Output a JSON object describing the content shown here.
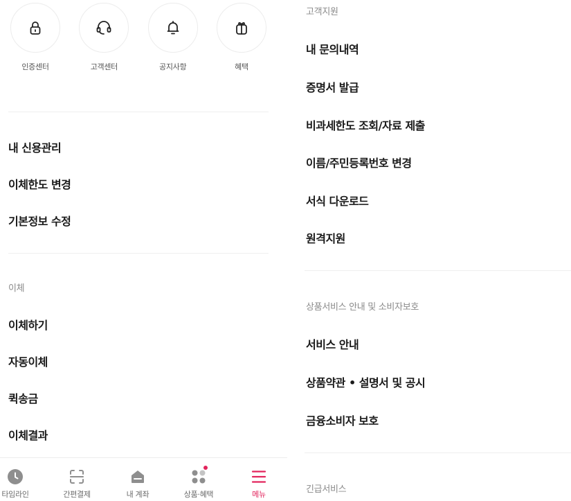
{
  "quick_menu": [
    {
      "label": "인증센터",
      "icon": "lock-icon"
    },
    {
      "label": "고객센터",
      "icon": "headset-icon"
    },
    {
      "label": "공지사항",
      "icon": "bell-icon"
    },
    {
      "label": "혜택",
      "icon": "gift-icon"
    }
  ],
  "left_menu": {
    "account_items": [
      "내 신용관리",
      "이체한도 변경",
      "기본정보 수정"
    ],
    "transfer_section": {
      "title": "이체",
      "items": [
        "이체하기",
        "자동이체",
        "퀵송금",
        "이체결과"
      ]
    }
  },
  "right_menu": {
    "support_section": {
      "title": "고객지원",
      "items": [
        "내 문의내역",
        "증명서 발급",
        "비과세한도 조회/자료 제출",
        "이름/주민등록번호 변경",
        "서식 다운로드",
        "원격지원"
      ]
    },
    "product_section": {
      "title": "상품서비스 안내 및 소비자보호",
      "items": [
        "서비스 안내",
        "상품약관 • 설명서 및 공시",
        "금융소비자 보호"
      ]
    },
    "emergency_section": {
      "title": "긴급서비스"
    }
  },
  "tabbar": {
    "tabs": [
      {
        "label": "타임라인",
        "icon": "clock-icon",
        "active": false
      },
      {
        "label": "간편결제",
        "icon": "scan-icon",
        "active": false
      },
      {
        "label": "내 계좌",
        "icon": "home-icon",
        "active": false
      },
      {
        "label": "상품·혜택",
        "icon": "dots-icon",
        "active": false,
        "badge": true
      },
      {
        "label": "메뉴",
        "icon": "hamburger-menu-icon",
        "active": true
      }
    ],
    "active_color": "#e2245c",
    "inactive_color": "#8e8e8e"
  }
}
